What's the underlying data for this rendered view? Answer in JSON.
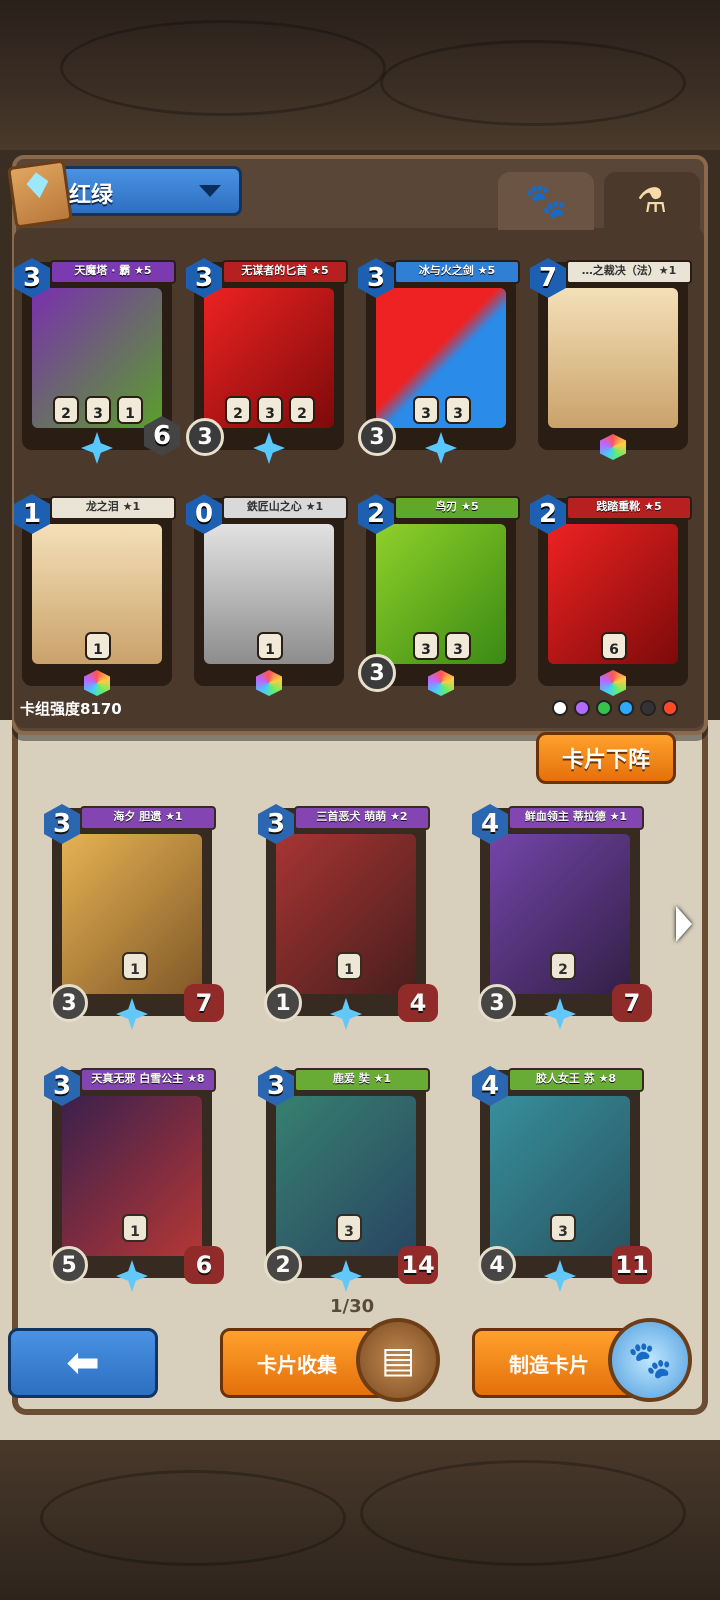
{
  "deck": {
    "name": "红绿",
    "strength": "卡组强度8170"
  },
  "tabs": [
    {
      "icon": "paw-icon"
    },
    {
      "icon": "potion-icon"
    }
  ],
  "deck_cards": [
    {
      "name": "天魔塔 · 霸 ★5",
      "cost": "3",
      "stats": [
        "2",
        "3",
        "1"
      ],
      "defense": "6",
      "style": "purple-green"
    },
    {
      "name": "无谋者的匕首 ★5",
      "cost": "3",
      "stats": [
        "2",
        "3",
        "2"
      ],
      "attack": "3",
      "style": "red"
    },
    {
      "name": "冰与火之剑 ★5",
      "cost": "3",
      "stats": [
        "3",
        "3"
      ],
      "attack": "3",
      "style": "blue-red"
    },
    {
      "name": "…之裁决（法）★1",
      "cost": "7",
      "stats": [],
      "style": "parchment"
    },
    {
      "name": "龙之泪 ★1",
      "cost": "1",
      "stats": [
        "1"
      ],
      "style": "parchment"
    },
    {
      "name": "鉄匠山之心 ★1",
      "cost": "0",
      "stats": [
        "1"
      ],
      "style": "silver"
    },
    {
      "name": "鸟刃 ★5",
      "cost": "2",
      "stats": [
        "3",
        "3"
      ],
      "attack": "3",
      "style": "green"
    },
    {
      "name": "践踏重靴 ★5",
      "cost": "2",
      "stats": [
        "6"
      ],
      "style": "red"
    }
  ],
  "unload_button": "卡片下阵",
  "collection_cards": [
    {
      "name": "海夕 胆遗 ★1",
      "cost": "3",
      "attack": "3",
      "hp": "7",
      "mid": "1"
    },
    {
      "name": "三首恶犬 萌萌 ★2",
      "cost": "3",
      "attack": "1",
      "hp": "4",
      "mid": "1"
    },
    {
      "name": "鲜血领主 蒂拉德 ★1",
      "cost": "4",
      "attack": "3",
      "hp": "7",
      "mid": "2"
    },
    {
      "name": "天真无邪 白雪公主 ★8",
      "cost": "3",
      "attack": "5",
      "hp": "6",
      "mid": "1"
    },
    {
      "name": "鹿爱 奘 ★1",
      "cost": "3",
      "attack": "2",
      "hp": "14",
      "mid": "3"
    },
    {
      "name": "胶人女王 苏 ★8",
      "cost": "4",
      "attack": "4",
      "hp": "11",
      "mid": "3"
    }
  ],
  "page": "1/30",
  "buttons": {
    "collect": "卡片收集",
    "craft": "制造卡片"
  },
  "element_colors": [
    "#ffffff",
    "#b36bff",
    "#37c24a",
    "#2fa8ff",
    "#333333",
    "#ff4a2a"
  ]
}
